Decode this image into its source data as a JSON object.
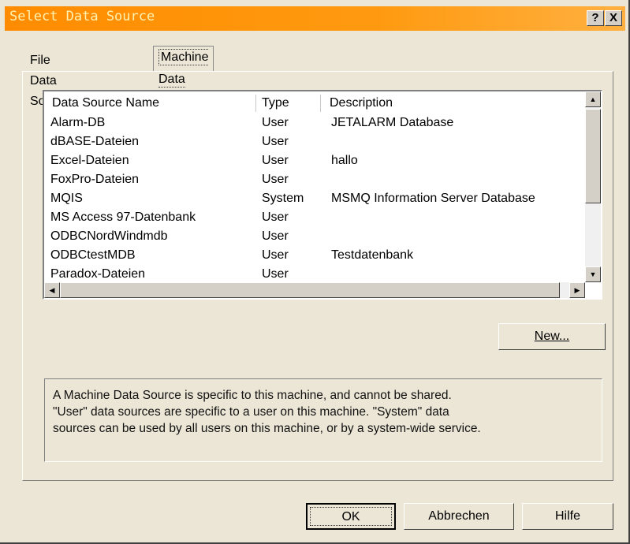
{
  "window": {
    "title": "Select Data Source",
    "help_label": "?",
    "close_label": "X"
  },
  "tabs": [
    {
      "label": "File Data Source",
      "active": false
    },
    {
      "label": "Machine Data Source",
      "active": true
    }
  ],
  "list": {
    "headers": {
      "name": "Data Source Name",
      "type": "Type",
      "description": "Description"
    },
    "rows": [
      {
        "name": "Alarm-DB",
        "type": "User",
        "description": "JETALARM Database"
      },
      {
        "name": "dBASE-Dateien",
        "type": "User",
        "description": ""
      },
      {
        "name": "Excel-Dateien",
        "type": "User",
        "description": "hallo"
      },
      {
        "name": "FoxPro-Dateien",
        "type": "User",
        "description": ""
      },
      {
        "name": "MQIS",
        "type": "System",
        "description": "MSMQ Information Server Database"
      },
      {
        "name": "MS Access 97-Datenbank",
        "type": "User",
        "description": ""
      },
      {
        "name": "ODBCNordWindmdb",
        "type": "User",
        "description": ""
      },
      {
        "name": "ODBCtestMDB",
        "type": "User",
        "description": "Testdatenbank"
      },
      {
        "name": "Paradox-Dateien",
        "type": "User",
        "description": ""
      }
    ]
  },
  "buttons": {
    "new": "New...",
    "ok": "OK",
    "cancel": "Abbrechen",
    "help": "Hilfe"
  },
  "info": {
    "line1": "A Machine Data Source is specific to this machine, and cannot be shared.",
    "line2": "\"User\" data sources are specific to a user on this machine.  \"System\" data",
    "line3": "sources can be used by all users on this machine, or by a system-wide service."
  },
  "colors": {
    "titlebar": "#ff8c00",
    "dialog_bg": "#ece6d6"
  }
}
